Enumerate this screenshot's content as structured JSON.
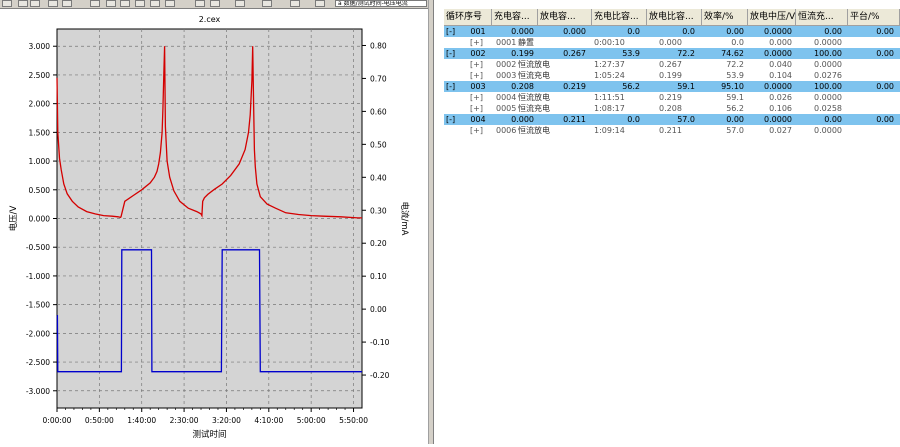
{
  "toolbar": {
    "combo_text": "a 数据/测试时间-电压电流"
  },
  "chart": {
    "title": "2.cex"
  },
  "chart_data": {
    "type": "line",
    "title": "2.cex",
    "xlabel": "测试时间",
    "ylabel": "电压/V",
    "y2label": "电流/mA",
    "xticks": [
      "0:00:00",
      "0:50:00",
      "1:40:00",
      "2:30:00",
      "3:20:00",
      "4:10:00",
      "5:00:00",
      "5:50:00"
    ],
    "yticks": [
      "3.000",
      "2.500",
      "2.000",
      "1.500",
      "1.000",
      "0.500",
      "0.000",
      "-0.500",
      "-1.000",
      "-1.500",
      "-2.000",
      "-2.500",
      "-3.000"
    ],
    "y2ticks": [
      "0.80",
      "0.70",
      "0.60",
      "0.50",
      "0.40",
      "0.30",
      "0.20",
      "0.10",
      "0.00",
      "-0.10",
      "-0.20"
    ],
    "xlim_minutes": [
      0,
      360
    ],
    "ylim": [
      -3.3,
      3.3
    ],
    "y2lim": [
      -0.3,
      0.85
    ],
    "grid": true,
    "series": [
      {
        "axis": "left",
        "color": "#d40000",
        "x": [
          0,
          1,
          3,
          5,
          8,
          12,
          18,
          25,
          35,
          45,
          55,
          65,
          72,
          75,
          75.5,
          80,
          90,
          100,
          110,
          115,
          118,
          120,
          122,
          124,
          125,
          126,
          127,
          128,
          130,
          133,
          138,
          145,
          155,
          165,
          170,
          171,
          172,
          174,
          178,
          185,
          195,
          205,
          215,
          222,
          226,
          228,
          230,
          231,
          232,
          233,
          234,
          236,
          240,
          248,
          258,
          270,
          285,
          300,
          315,
          335,
          355,
          360
        ],
        "y": [
          2.45,
          1.5,
          1.05,
          0.85,
          0.6,
          0.43,
          0.3,
          0.2,
          0.12,
          0.08,
          0.05,
          0.04,
          0.03,
          0.02,
          0.03,
          0.3,
          0.4,
          0.5,
          0.62,
          0.72,
          0.82,
          0.95,
          1.15,
          1.5,
          1.9,
          2.5,
          3.0,
          1.6,
          1.0,
          0.72,
          0.48,
          0.3,
          0.18,
          0.12,
          0.08,
          0.05,
          0.3,
          0.36,
          0.42,
          0.5,
          0.6,
          0.75,
          0.95,
          1.2,
          1.5,
          1.8,
          2.4,
          3.0,
          2.0,
          1.2,
          0.9,
          0.6,
          0.38,
          0.25,
          0.18,
          0.1,
          0.07,
          0.05,
          0.04,
          0.03,
          0.01,
          0.01
        ]
      },
      {
        "axis": "right",
        "color": "#0000cc",
        "x": [
          0,
          0.5,
          1,
          2,
          73,
          74,
          75,
          76,
          76.5,
          77,
          110,
          111,
          111.5,
          112,
          113,
          190,
          191,
          192,
          193,
          194,
          195,
          235,
          236,
          237,
          238,
          239,
          240,
          275,
          276,
          277,
          278,
          279,
          280,
          360
        ],
        "y": [
          -0.02,
          -0.02,
          -0.19,
          -0.19,
          -0.19,
          -0.19,
          -0.19,
          -0.19,
          0.18,
          0.18,
          0.18,
          0.18,
          0.18,
          -0.19,
          -0.19,
          -0.19,
          -0.19,
          -0.19,
          -0.19,
          -0.19,
          0.18,
          0.18,
          0.18,
          0.18,
          0.18,
          0.18,
          -0.19,
          -0.19,
          -0.19,
          -0.19,
          -0.19,
          -0.19,
          -0.19,
          -0.19
        ]
      }
    ]
  },
  "table": {
    "headers": [
      "循环序号",
      "充电容...",
      "放电容...",
      "充电比容...",
      "放电比容...",
      "效率/%",
      "放电中压/V",
      "恒流充...",
      "平台/%"
    ],
    "rows": [
      {
        "kind": "cycle",
        "toggle": "[-]",
        "c1": "001",
        "c2": "0.000",
        "c3": "0.000",
        "c4": "0.0",
        "c5": "0.0",
        "c6": "0.00",
        "c7": "0.0000",
        "c8": "0.00",
        "c9": "0.00"
      },
      {
        "kind": "step",
        "toggle": "[+]",
        "id": "0001",
        "label": "静置",
        "time": "0:00:10",
        "cap": "0.000",
        "c6": "0.0",
        "c7": "0.000",
        "c8": "0.0000"
      },
      {
        "kind": "cycle",
        "toggle": "[-]",
        "c1": "002",
        "c2": "0.199",
        "c3": "0.267",
        "c4": "53.9",
        "c5": "72.2",
        "c6": "74.62",
        "c7": "0.0000",
        "c8": "100.00",
        "c9": "0.00"
      },
      {
        "kind": "step",
        "toggle": "[+]",
        "id": "0002",
        "label": "恒流放电",
        "time": "1:27:37",
        "cap": "0.267",
        "c6": "72.2",
        "c7": "0.040",
        "c8": "0.0000"
      },
      {
        "kind": "step",
        "toggle": "[+]",
        "id": "0003",
        "label": "恒流充电",
        "time": "1:05:24",
        "cap": "0.199",
        "c6": "53.9",
        "c7": "0.104",
        "c8": "0.0276"
      },
      {
        "kind": "cycle",
        "toggle": "[-]",
        "c1": "003",
        "c2": "0.208",
        "c3": "0.219",
        "c4": "56.2",
        "c5": "59.1",
        "c6": "95.10",
        "c7": "0.0000",
        "c8": "100.00",
        "c9": "0.00"
      },
      {
        "kind": "step",
        "toggle": "[+]",
        "id": "0004",
        "label": "恒流放电",
        "time": "1:11:51",
        "cap": "0.219",
        "c6": "59.1",
        "c7": "0.026",
        "c8": "0.0000"
      },
      {
        "kind": "step",
        "toggle": "[+]",
        "id": "0005",
        "label": "恒流充电",
        "time": "1:08:17",
        "cap": "0.208",
        "c6": "56.2",
        "c7": "0.106",
        "c8": "0.0258"
      },
      {
        "kind": "cycle",
        "toggle": "[-]",
        "c1": "004",
        "c2": "0.000",
        "c3": "0.211",
        "c4": "0.0",
        "c5": "57.0",
        "c6": "0.00",
        "c7": "0.0000",
        "c8": "0.00",
        "c9": "0.00"
      },
      {
        "kind": "step",
        "toggle": "[+]",
        "id": "0006",
        "label": "恒流放电",
        "time": "1:09:14",
        "cap": "0.211",
        "c6": "57.0",
        "c7": "0.027",
        "c8": "0.0000"
      }
    ]
  }
}
